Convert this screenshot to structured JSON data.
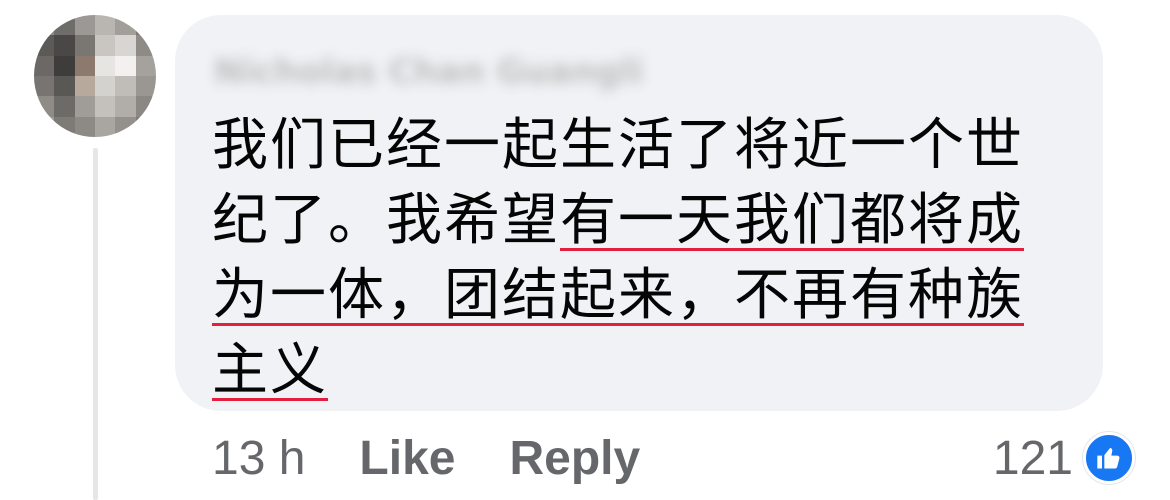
{
  "comment": {
    "author_name": "Nicholas Chan Guangli",
    "lines": [
      {
        "plain": "我们已经一起生活了将近一个世",
        "underlined": ""
      },
      {
        "plain": "纪了。我希望",
        "underlined": "有一天我们都将成"
      },
      {
        "plain": "",
        "underlined": "为一体，团结起来，不再有种族"
      },
      {
        "plain": "",
        "underlined": "主义"
      }
    ]
  },
  "footer": {
    "time": "13 h",
    "like_label": "Like",
    "reply_label": "Reply"
  },
  "reactions": {
    "count": "121",
    "icon": "thumbs-up-icon",
    "badge_color": "#1877f2"
  },
  "colors": {
    "underline": "#e41e3f",
    "bubble": "#f0f2f5",
    "muted_text": "#65676b"
  }
}
